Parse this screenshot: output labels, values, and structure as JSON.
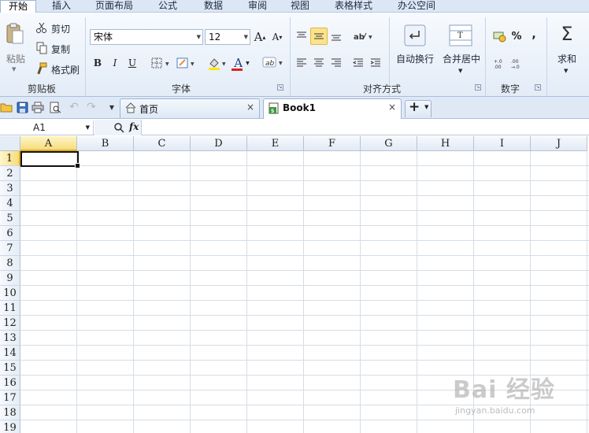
{
  "menu": {
    "tabs": [
      "开始",
      "插入",
      "页面布局",
      "公式",
      "数据",
      "审阅",
      "视图",
      "表格样式",
      "办公空间"
    ],
    "active": "开始"
  },
  "ribbon": {
    "clipboard": {
      "label": "剪贴板",
      "paste": "粘贴",
      "cut": "剪切",
      "copy": "复制",
      "format_painter": "格式刷"
    },
    "font": {
      "label": "字体",
      "font_name": "宋体",
      "font_size": "12",
      "bold": "B",
      "italic": "I",
      "underline": "U",
      "grow": "A",
      "shrink": "A",
      "font_color_glyph": "A"
    },
    "alignment": {
      "label": "对齐方式",
      "wrap_text": "自动换行",
      "merge_center": "合并居中"
    },
    "number": {
      "label": "数字",
      "percent": "%",
      "comma": ","
    },
    "editing": {
      "sum": "求和",
      "sum_glyph": "Σ"
    }
  },
  "doc_tabs": {
    "home": "首页",
    "book": "Book1",
    "add_glyph": "+",
    "close_glyph": "×"
  },
  "formula_bar": {
    "name_box": "A1",
    "fx_glyph": "fx"
  },
  "grid": {
    "columns": [
      "A",
      "B",
      "C",
      "D",
      "E",
      "F",
      "G",
      "H",
      "I",
      "J"
    ],
    "rows": [
      "1",
      "2",
      "3",
      "4",
      "5",
      "6",
      "7",
      "8",
      "9",
      "10",
      "11",
      "12",
      "13",
      "14",
      "15",
      "16",
      "17",
      "18",
      "19"
    ],
    "active_cell": "A1"
  },
  "watermark": {
    "text": "Bai 经验",
    "sub": "jingyan.baidu.com"
  },
  "colors": {
    "accent_highlight": "#fbe38d",
    "ribbon_bg": "#e3ecf7",
    "font_color_red": "#e02020",
    "fill_color_yellow": "#ffe800"
  }
}
